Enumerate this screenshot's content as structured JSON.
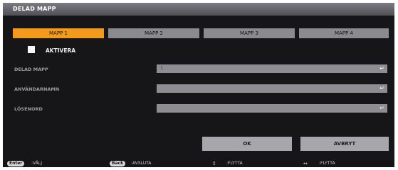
{
  "dialog": {
    "title": "DELAD MAPP"
  },
  "tabs": [
    {
      "label": "MAPP 1",
      "active": true
    },
    {
      "label": "MAPP 2",
      "active": false
    },
    {
      "label": "MAPP 3",
      "active": false
    },
    {
      "label": "MAPP 4",
      "active": false
    }
  ],
  "enable": {
    "label": "AKTIVERA",
    "checked": false
  },
  "fields": {
    "shared_folder": {
      "label": "DELAD MAPP",
      "value": "\\"
    },
    "username": {
      "label": "ANVÄNDARNAMN",
      "value": ""
    },
    "password": {
      "label": "LÖSENORD",
      "value": ""
    }
  },
  "buttons": {
    "ok": "OK",
    "cancel": "AVBRYT"
  },
  "footer": {
    "enter_key": "Enter",
    "enter_hint": ":VÄLJ",
    "back_key": "Back",
    "back_hint": ":AVSLUTA",
    "updown_icon": "↕",
    "updown_hint": ":FLYTTA",
    "leftright_icon": "↔",
    "leftright_hint": ":FLYTTA"
  },
  "icons": {
    "enter": "↵"
  },
  "colors": {
    "accent": "#f39a1c",
    "dialog_bg": "#161619",
    "field_bg": "#8d8d92",
    "button_bg": "#a7a7ab"
  }
}
